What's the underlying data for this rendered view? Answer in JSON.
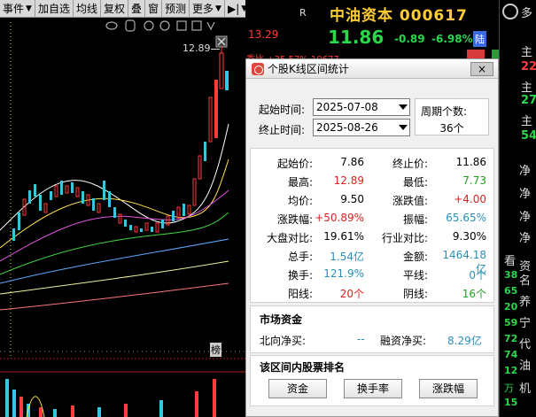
{
  "toolbar": {
    "items": [
      "事件",
      "加自选",
      "均线",
      "复权",
      "叠",
      "窗",
      "预测",
      "更多"
    ]
  },
  "chart": {
    "peak_label": "12.89",
    "corner_tag": "榜",
    "right_price": "13.29"
  },
  "quote": {
    "flag": "R",
    "name_code": "中油资本 000617",
    "price": "11.86",
    "change": "-0.89",
    "change_pct": "-6.98%",
    "board": "陆",
    "strip_text": "季比 +35.57%   10677"
  },
  "sidebar": {
    "texts": [
      "多",
      "主",
      "主",
      "主",
      "净",
      "净",
      "净",
      "净",
      "看",
      "资",
      "名",
      "养",
      "宁",
      "代",
      "油",
      "机",
      "万"
    ],
    "nums": [
      "22",
      "27",
      "54",
      "38",
      "65",
      "20",
      "59",
      "72",
      "74",
      "12",
      "15"
    ]
  },
  "dialog": {
    "title": "个股K线区间统计",
    "close": "×",
    "start_label": "起始时间:",
    "start_value": "2025-07-08",
    "end_label": "终止时间:",
    "end_value": "2025-08-26",
    "period_label": "周期个数:",
    "period_value": "36个",
    "stats": [
      {
        "l1": "起始价:",
        "v1": "7.86",
        "c1": "#000000",
        "l2": "终止价:",
        "v2": "11.86",
        "c2": "#000000"
      },
      {
        "l1": "最高:",
        "v1": "12.89",
        "c1": "#e02020",
        "l2": "最低:",
        "v2": "7.73",
        "c2": "#20a020"
      },
      {
        "l1": "均价:",
        "v1": "9.50",
        "c1": "#000000",
        "l2": "涨跌值:",
        "v2": "+4.00",
        "c2": "#e02020"
      },
      {
        "l1": "涨跌幅:",
        "v1": "+50.89%",
        "c1": "#e02020",
        "l2": "振幅:",
        "v2": "65.65%",
        "c2": "#2a8fb8"
      },
      {
        "l1": "大盘对比:",
        "v1": "19.61%",
        "c1": "#000000",
        "l2": "行业对比:",
        "v2": "9.30%",
        "c2": "#000000"
      },
      {
        "l1": "总手:",
        "v1": "1.54亿",
        "c1": "#2a8fb8",
        "l2": "金额:",
        "v2": "1464.18亿",
        "c2": "#2a8fb8"
      },
      {
        "l1": "换手:",
        "v1": "121.9%",
        "c1": "#2a8fb8",
        "l2": "平线:",
        "v2": "0个",
        "c2": "#2a8fb8"
      },
      {
        "l1": "阳线:",
        "v1": "20个",
        "c1": "#e02020",
        "l2": "阴线:",
        "v2": "16个",
        "c2": "#20a020"
      }
    ],
    "market_title": "市场资金",
    "north_label": "北向净买:",
    "north_value": "--",
    "margin_label": "融资净买:",
    "margin_value": "8.29亿",
    "rank_title": "该区间内股票排名",
    "rank_buttons": [
      "资金",
      "换手率",
      "涨跌幅"
    ]
  }
}
